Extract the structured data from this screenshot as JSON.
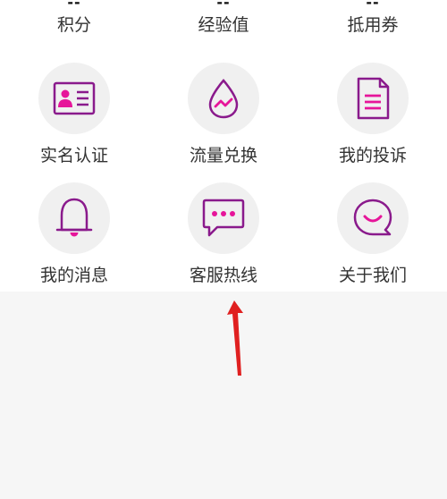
{
  "stats": [
    {
      "value": "--",
      "label": "积分"
    },
    {
      "value": "--",
      "label": "经验值"
    },
    {
      "value": "--",
      "label": "抵用券"
    }
  ],
  "grid": [
    {
      "label": "实名认证",
      "icon": "id-card-icon"
    },
    {
      "label": "流量兑换",
      "icon": "data-drop-icon"
    },
    {
      "label": "我的投诉",
      "icon": "document-icon"
    },
    {
      "label": "我的消息",
      "icon": "bell-icon"
    },
    {
      "label": "客服热线",
      "icon": "chat-bubble-icon"
    },
    {
      "label": "关于我们",
      "icon": "smile-bubble-icon"
    }
  ],
  "colors": {
    "accent_magenta": "#e6159a",
    "icon_purple": "#8a1a8c",
    "arrow_red": "#e02020"
  }
}
